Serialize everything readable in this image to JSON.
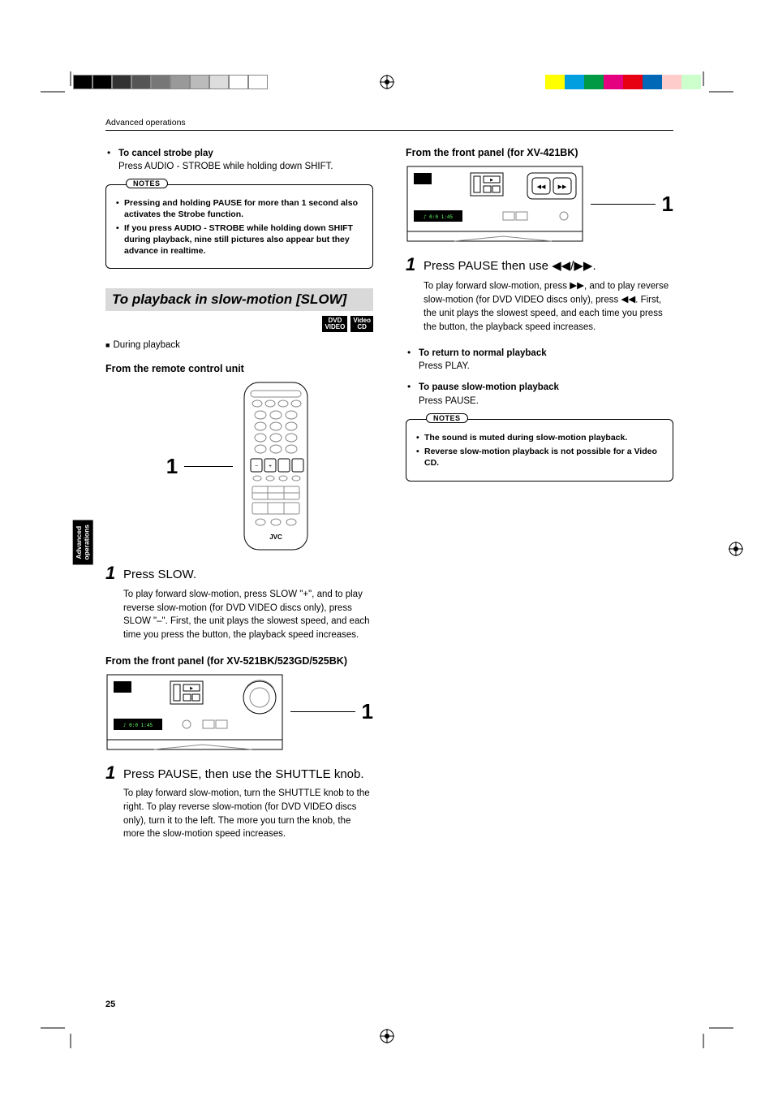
{
  "header": {
    "section": "Advanced operations"
  },
  "sideTab": {
    "line1": "Advanced",
    "line2": "operations"
  },
  "pageNumber": "25",
  "colorBars": {
    "left": [
      "#000000",
      "#000000",
      "#333333",
      "#555555",
      "#777777",
      "#999999",
      "#bbbbbb",
      "#dddddd",
      "#ffffff",
      "#ffffff"
    ],
    "right": [
      "#ffff00",
      "#00a0e0",
      "#009944",
      "#e4007f",
      "#e60012",
      "#0068b7",
      "#ffcccc",
      "#ccffcc"
    ]
  },
  "left": {
    "cancel": {
      "title": "To cancel strobe play",
      "body": "Press AUDIO - STROBE while holding down SHIFT."
    },
    "notes1": {
      "label": "NOTES",
      "items": [
        "Pressing and holding PAUSE for more than 1 second also activates the Strobe function.",
        "If you press AUDIO - STROBE while holding down SHIFT during playback, nine still pictures also appear but they advance in realtime."
      ]
    },
    "slowSection": {
      "title": "To playback in slow-motion [SLOW]",
      "badges": [
        "DVD\nVIDEO",
        "Video\nCD"
      ],
      "during": "During playback",
      "fromRemote": "From the remote control unit",
      "figCallout": "1",
      "step1": {
        "num": "1",
        "title": "Press SLOW.",
        "body": "To play forward slow-motion, press SLOW \"+\", and to play reverse slow-motion (for DVD VIDEO discs only), press SLOW \"–\". First, the unit plays the slowest speed, and each time you press the button, the playback speed increases."
      },
      "fromPanel521": "From the front panel (for XV-521BK/523GD/525BK)",
      "panelCallout521": "1",
      "step2": {
        "num": "1",
        "title": "Press PAUSE, then use the SHUTTLE knob.",
        "body": "To play forward slow-motion, turn the SHUTTLE knob to the right. To play reverse slow-motion (for DVD VIDEO discs only), turn it to the left. The more you turn the knob, the more the slow-motion speed increases."
      }
    }
  },
  "right": {
    "fromPanel421": "From the front panel (for XV-421BK)",
    "panelCallout421": "1",
    "step1": {
      "num": "1",
      "titlePrefix": "Press PAUSE then use ",
      "titleSuffix": ".",
      "bodyA": "To play forward slow-motion, press ",
      "bodyB": ", and to play reverse slow-motion (for DVD VIDEO discs only), press ",
      "bodyC": ". First, the unit plays the slowest speed, and each time you press the button, the playback speed increases."
    },
    "returnNormal": {
      "title": "To return to normal playback",
      "body": "Press PLAY."
    },
    "pauseSlow": {
      "title": "To pause slow-motion playback",
      "body": "Press PAUSE."
    },
    "notes2": {
      "label": "NOTES",
      "items": [
        "The sound is muted during slow-motion playback.",
        "Reverse slow-motion playback is not possible for a Video CD."
      ]
    }
  }
}
